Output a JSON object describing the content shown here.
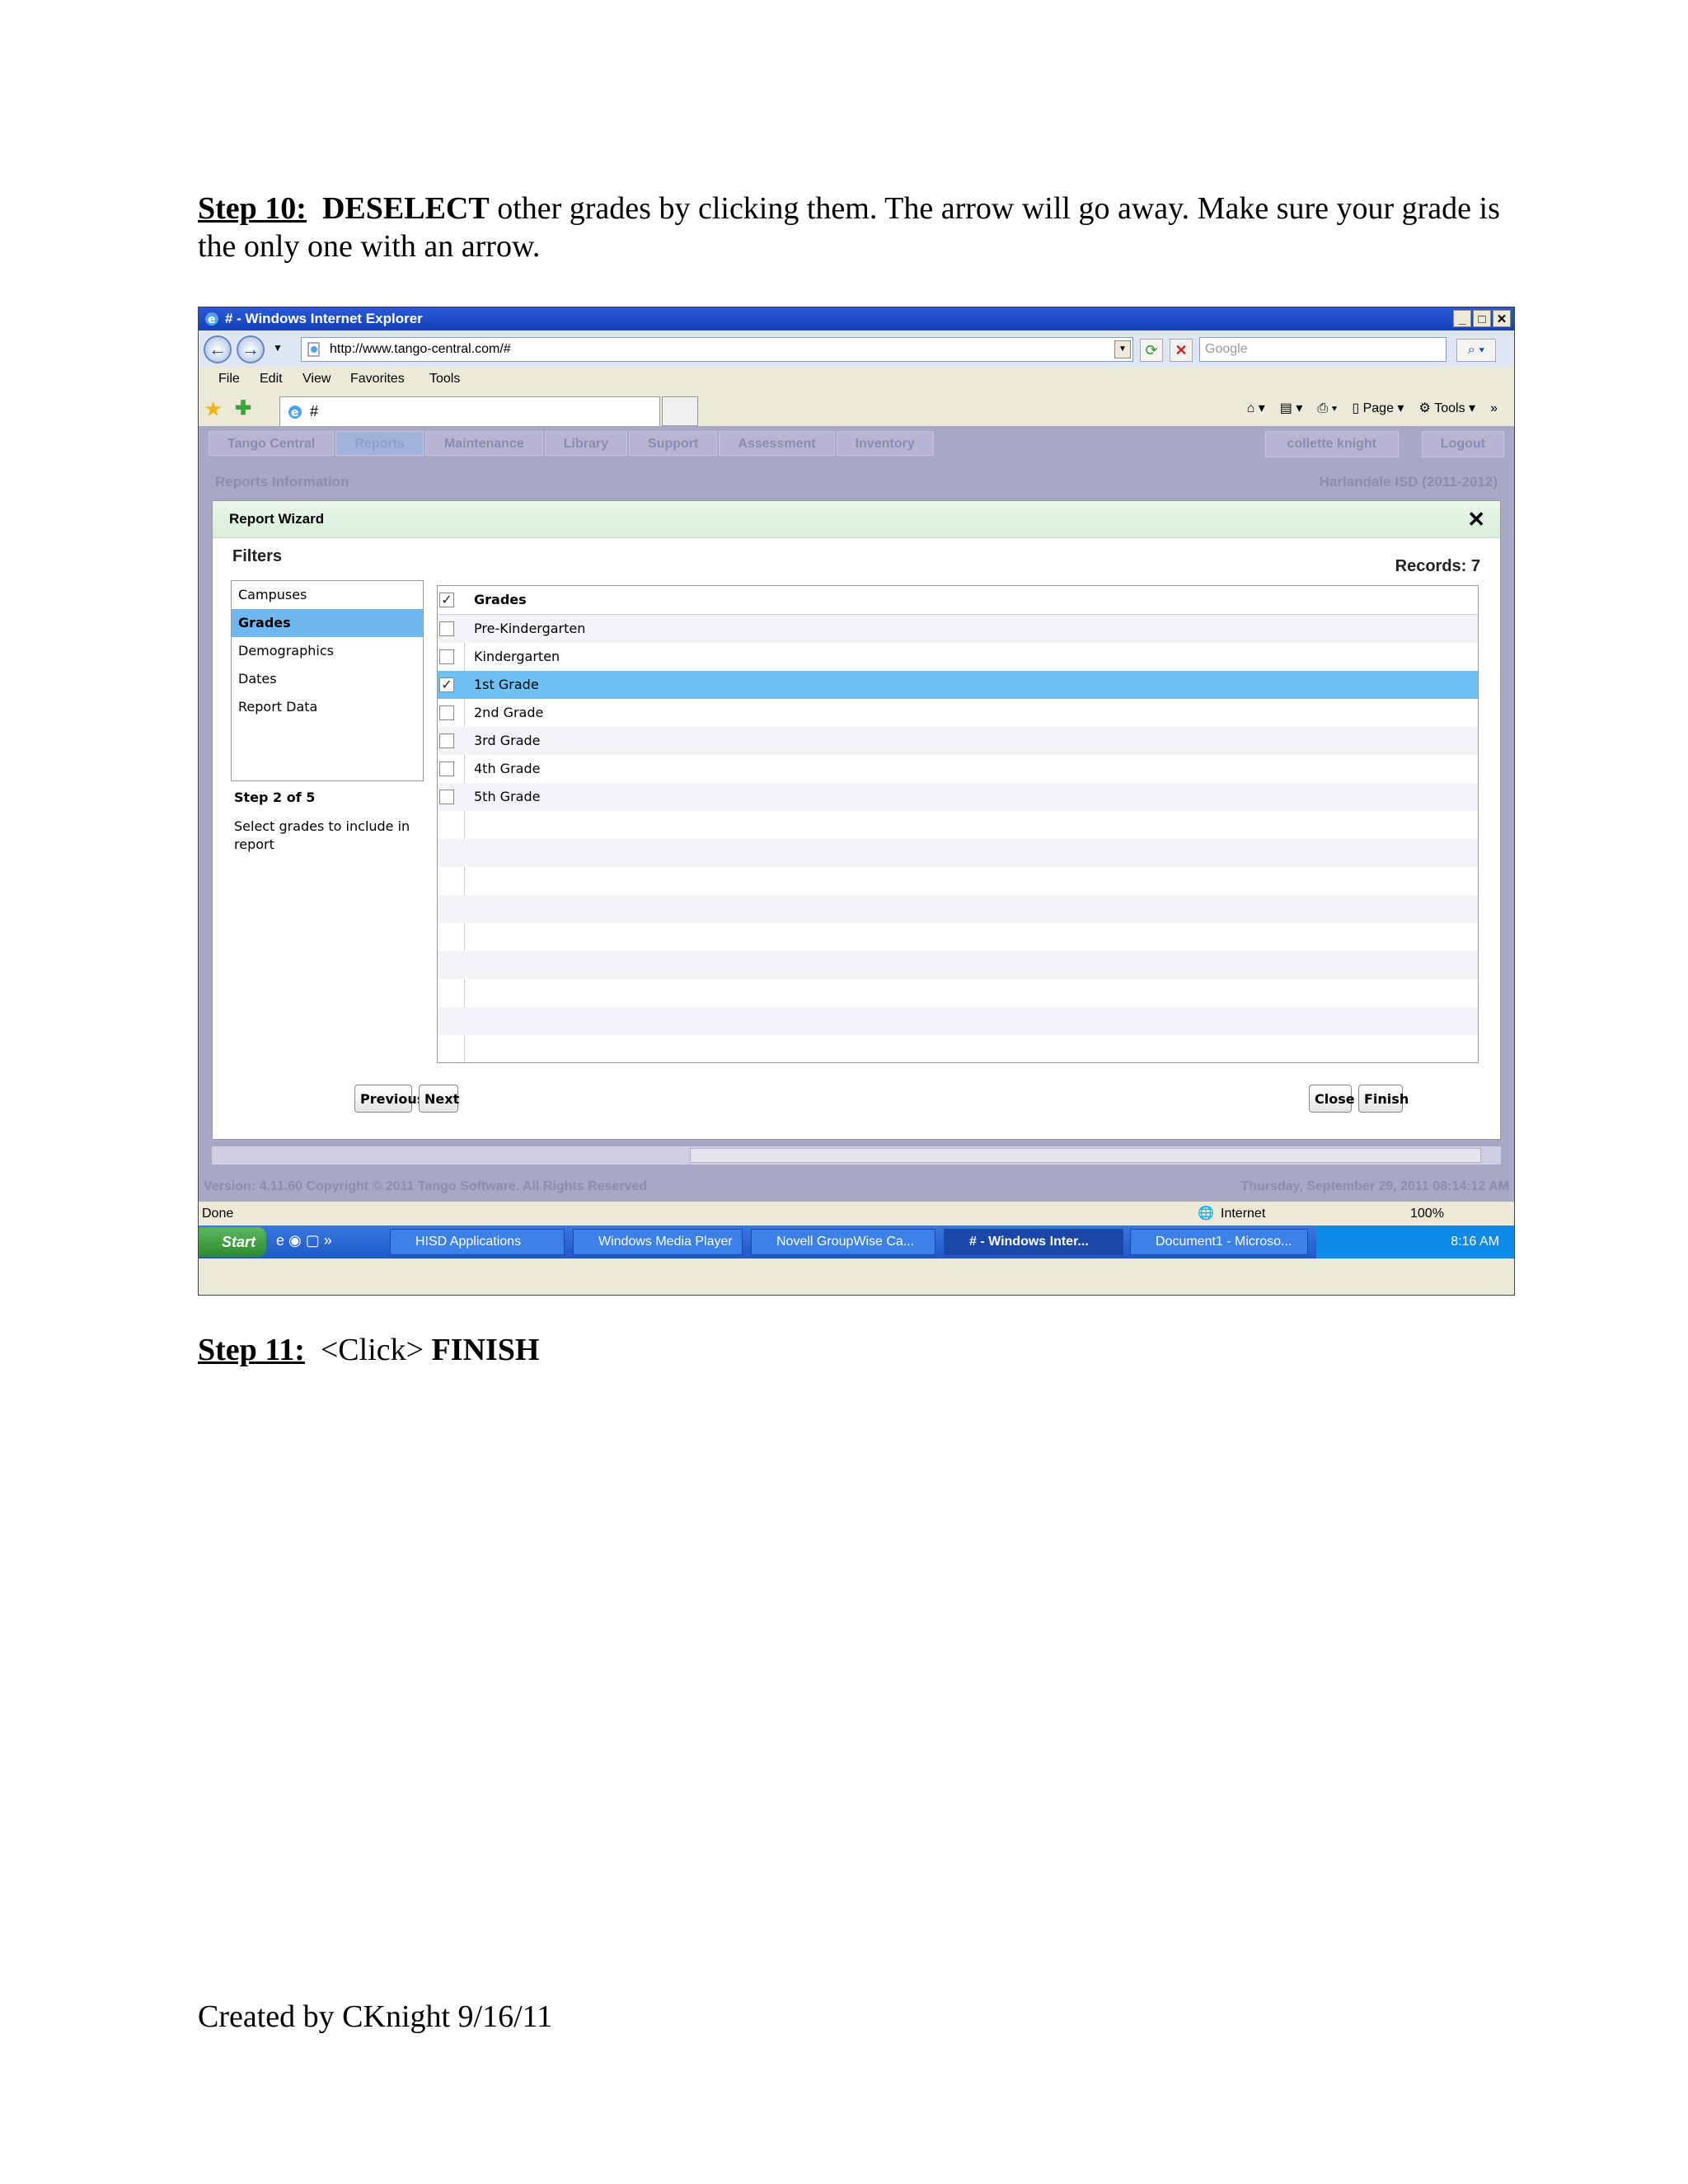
{
  "instructions": {
    "step10_label": "Step 10:",
    "step10_bold": "DESELECT",
    "step10_text": "other grades by clicking them.  The arrow will go away.  Make sure your grade is the only one with an arrow.",
    "step11_label": "Step 11:",
    "step11_text": "<Click>",
    "step11_bold": "FINISH",
    "footer": "Created by CKnight 9/16/11"
  },
  "browser": {
    "window_title": "# - Windows Internet Explorer",
    "address": "http://www.tango-central.com/#",
    "search_placeholder": "Google",
    "menu": [
      "File",
      "Edit",
      "View",
      "Favorites",
      "Tools"
    ],
    "tab_title": "#",
    "cmd_page": "Page",
    "cmd_tools": "Tools",
    "status_done": "Done",
    "status_zone": "Internet",
    "zoom": "100%"
  },
  "app": {
    "tabs": [
      "Tango Central",
      "Reports",
      "Maintenance",
      "Library",
      "Support",
      "Assessment",
      "Inventory"
    ],
    "user": "collette knight",
    "logout": "Logout",
    "section": "Reports Information",
    "district": "Harlandale ISD (2011-2012)",
    "version": "Version: 4.11.60    Copyright © 2011 Tango Software. All Rights Reserved",
    "date": "Thursday, September 29, 2011 08:14:12 AM"
  },
  "wizard": {
    "title": "Report Wizard",
    "close": "✕",
    "filters_title": "Filters",
    "records": "Records: 7",
    "filters": [
      "Campuses",
      "Grades",
      "Demographics",
      "Dates",
      "Report Data"
    ],
    "selected_filter": "Grades",
    "step": "Step 2 of 5",
    "step_desc": "Select grades to include in report",
    "grid_header": "Grades",
    "grades": [
      {
        "name": "Pre-Kindergarten",
        "checked": false
      },
      {
        "name": "Kindergarten",
        "checked": false
      },
      {
        "name": "1st Grade",
        "checked": true
      },
      {
        "name": "2nd Grade",
        "checked": false
      },
      {
        "name": "3rd Grade",
        "checked": false
      },
      {
        "name": "4th Grade",
        "checked": false
      },
      {
        "name": "5th Grade",
        "checked": false
      }
    ],
    "btn_previous": "Previous",
    "btn_next": "Next",
    "btn_close": "Close",
    "btn_finish": "Finish"
  },
  "taskbar": {
    "start": "Start",
    "items": [
      "HISD Applications",
      "Windows Media Player",
      "Novell GroupWise Ca...",
      "# - Windows Inter...",
      "Document1 - Microso..."
    ],
    "active_index": 3,
    "clock": "8:16 AM"
  }
}
